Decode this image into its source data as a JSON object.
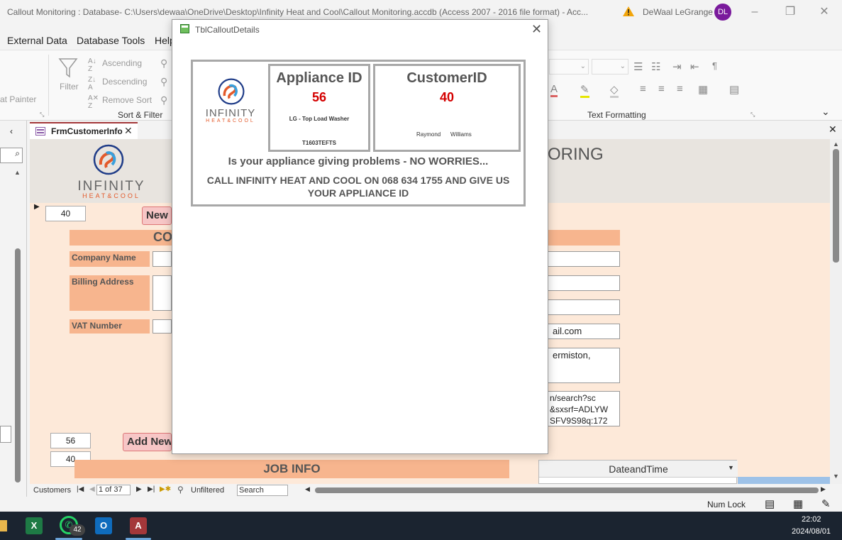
{
  "window": {
    "title": "Callout Monitoring : Database- C:\\Users\\dewaa\\OneDrive\\Desktop\\Infinity Heat and Cool\\Callout Monitoring.accdb (Access 2007 - 2016 file format)  -  Acc...",
    "user_name": "DeWaal LeGrange",
    "avatar_initials": "DL",
    "avatar_color": "#7a1a9c"
  },
  "menu": {
    "items": [
      "External Data",
      "Database Tools",
      "Help"
    ]
  },
  "ribbon": {
    "format_painter": "at Painter",
    "filter": "Filter",
    "ascending": "Ascending",
    "descending": "Descending",
    "remove_sort": "Remove Sort",
    "sort_filter_group": "Sort & Filter",
    "text_formatting_group": "Text Formatting"
  },
  "doc_tab": {
    "label": "FrmCustomerInfo"
  },
  "form": {
    "logo_text": "INFINITY",
    "logo_sub": "HEAT&COOL",
    "heading_fragment": "ORING",
    "record_id": "40",
    "new_button": "New",
    "section_fragment": "CO",
    "labels": {
      "company": "Company Name",
      "billing": "Billing Address",
      "vat": "VAT Number"
    },
    "email_fragment": "ail.com",
    "address_fragment": "ermiston,",
    "url_fragment_1": "n/search?sc",
    "url_fragment_2": "&sxsrf=ADLYW",
    "url_fragment_3": "SFV9S98q:172",
    "appliance_id": "56",
    "customer_id": "40",
    "add_new_button": "Add New",
    "job_info": "JOB INFO",
    "datetime_header": "DateandTime"
  },
  "record_nav": {
    "label": "Customers",
    "position": "1 of 37",
    "filter": "Unfiltered",
    "search": "Search"
  },
  "status": {
    "num_lock": "Num Lock"
  },
  "taskbar": {
    "whatsapp_badge": "42",
    "time": "22:02",
    "date": "2024/08/01"
  },
  "popup": {
    "title": "TblCalloutDetails",
    "logo_text": "INFINITY",
    "logo_sub": "HEAT&COOL",
    "appliance_header": "Appliance ID",
    "appliance_id": "56",
    "appliance_desc": "LG - Top Load Washer",
    "model": "T1603TEFTS",
    "customer_header": "CustomerID",
    "customer_id": "40",
    "first_name": "Raymond",
    "last_name": "Williams",
    "message_1": "Is your appliance giving problems - NO WORRIES...",
    "message_2": "CALL INFINITY HEAT AND COOL ON 068 634 1755 AND GIVE US YOUR APPLIANCE ID"
  }
}
